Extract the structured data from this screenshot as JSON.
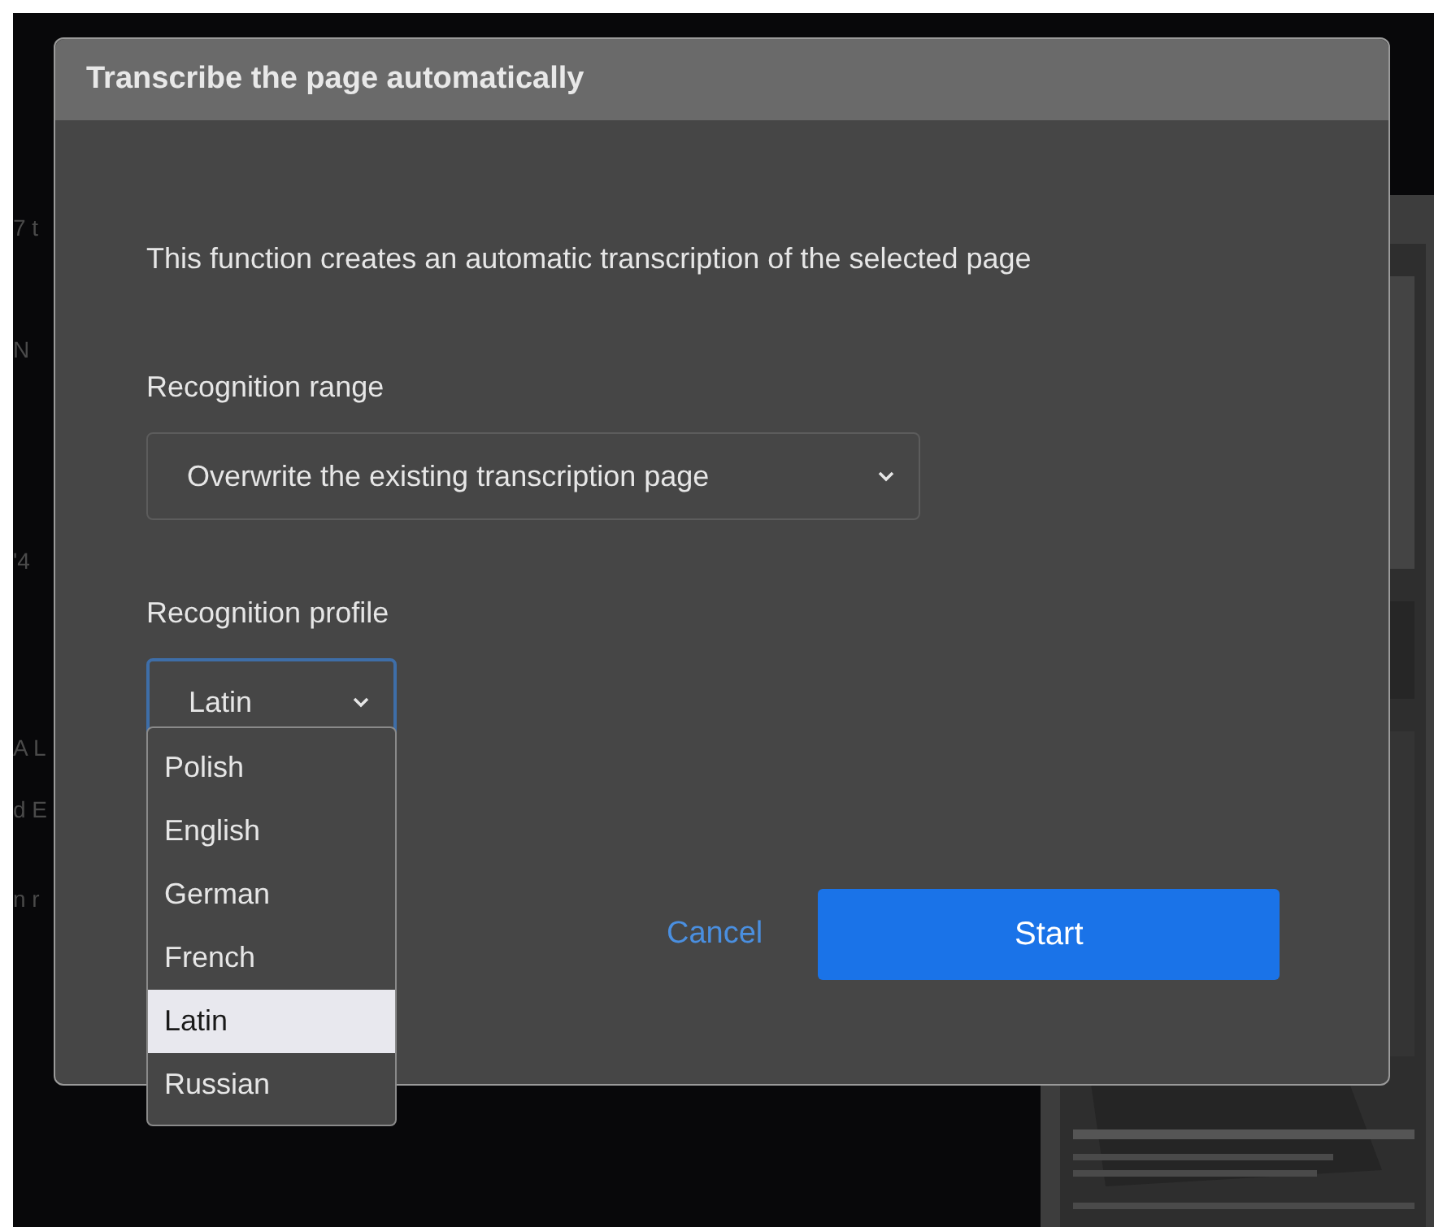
{
  "background_texts": [
    "7 t",
    "N",
    "'4",
    "A L",
    "d E",
    "n r"
  ],
  "window": {
    "title": "Transcribe the page automatically"
  },
  "description": "This function creates an automatic transcription of the selected page",
  "fields": [
    {
      "label": "Recognition range",
      "value": "Overwrite the existing transcription page",
      "focused": false
    },
    {
      "label": "Recognition profile",
      "value": "Latin",
      "focused": true,
      "expanded": true
    }
  ],
  "dropdown": {
    "options": [
      {
        "label": "Polish",
        "selected": false
      },
      {
        "label": "English",
        "selected": false
      },
      {
        "label": "German",
        "selected": false
      },
      {
        "label": "French",
        "selected": false
      },
      {
        "label": "Latin",
        "selected": true
      },
      {
        "label": "Russian",
        "selected": false
      }
    ]
  },
  "buttons": [
    {
      "label": "Cancel",
      "kind": "link"
    },
    {
      "label": "Start",
      "kind": "primary"
    }
  ]
}
